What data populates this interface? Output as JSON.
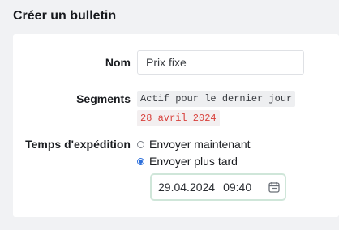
{
  "title": "Créer un bulletin",
  "form": {
    "name_label": "Nom",
    "name_value": "Prix fixe",
    "segments_label": "Segments",
    "segment_text": "Actif pour le dernier jour",
    "segment_date": "28 avril 2024",
    "send_time_label": "Temps d'expédition",
    "send_now": "Envoyer maintenant",
    "send_later": "Envoyer plus tard",
    "selected_option": "send_later",
    "date_value": "29.04.2024",
    "time_value": "09:40"
  },
  "icons": {
    "calendar": "calendar-icon"
  },
  "colors": {
    "accent": "#2d6fdb",
    "date_red": "#d8403b",
    "focus_border": "#cfe6d9"
  }
}
